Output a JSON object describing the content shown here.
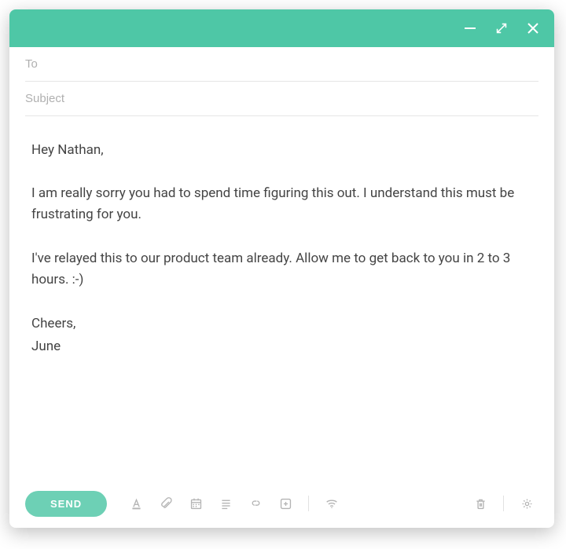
{
  "colors": {
    "accent": "#4ec7a6",
    "sendBg": "#6dd0b5"
  },
  "fields": {
    "to_placeholder": "To",
    "to_value": "",
    "subject_placeholder": "Subject",
    "subject_value": ""
  },
  "body": {
    "greeting": "Hey Nathan,",
    "p1": "I am really sorry you had to spend time figuring this out. I understand this must be frustrating for you.",
    "p2": "I've relayed this to our product team already. Allow me to get back to you in 2 to 3 hours. :-)",
    "closing": "Cheers,",
    "signature": "June"
  },
  "footer": {
    "send_label": "SEND"
  },
  "icons": {
    "minimize": "minimize-icon",
    "expand": "expand-icon",
    "close": "close-icon",
    "textcolor": "text-color-icon",
    "attach": "attachment-icon",
    "calendar": "calendar-icon",
    "list": "list-icon",
    "link": "link-icon",
    "plus": "insert-icon",
    "wifi": "wifi-icon",
    "trash": "trash-icon",
    "gear": "gear-icon"
  }
}
